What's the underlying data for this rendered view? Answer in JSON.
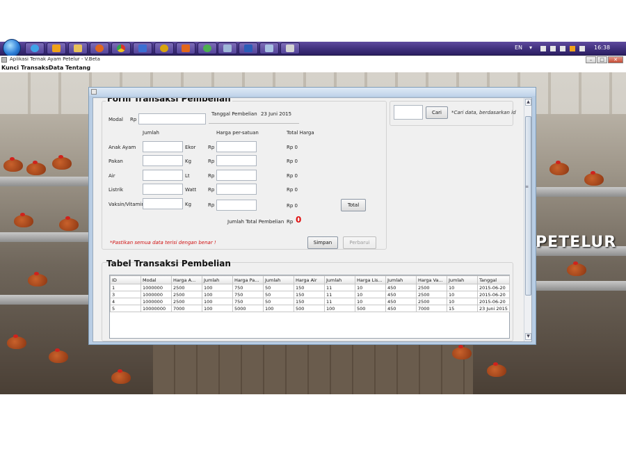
{
  "taskbar": {
    "language": "EN",
    "clock": "16:38",
    "pinned": [
      "start-orb",
      "ie-icon",
      "media-icon",
      "explorer-icon",
      "firefox-icon",
      "chrome-icon",
      "security-icon",
      "app-icon",
      "office-icon",
      "network-icon",
      "files-icon",
      "word-icon",
      "keyboard-icon",
      "java-app-icon"
    ]
  },
  "app": {
    "title": "Aplikasi Ternak Ayam Petelur - V.Beta",
    "menu": [
      "Kunci",
      "Transaksi",
      "Data",
      "Tentang"
    ],
    "brand_text": "PETELUR"
  },
  "form": {
    "title": "Form Transaksi Pembelian",
    "modal_label": "Modal",
    "currency": "Rp",
    "modal_value": "",
    "tanggal_label": "Tanggal Pembelian",
    "tanggal_value": "23 Juni 2015",
    "col_jumlah": "Jumlah",
    "col_harga": "Harga per-satuan",
    "col_total": "Total Harga",
    "rows": [
      {
        "label": "Anak Ayam",
        "unit": "Ekor",
        "jumlah": "",
        "harga": "",
        "total": "Rp  0"
      },
      {
        "label": "Pakan",
        "unit": "Kg",
        "jumlah": "",
        "harga": "",
        "total": "Rp  0"
      },
      {
        "label": "Air",
        "unit": "Lt",
        "jumlah": "",
        "harga": "",
        "total": "Rp  0"
      },
      {
        "label": "Listrik",
        "unit": "Watt",
        "jumlah": "",
        "harga": "",
        "total": "Rp  0"
      },
      {
        "label": "Vaksin/Vitamin",
        "unit": "Kg",
        "jumlah": "",
        "harga": "",
        "total": "Rp  0"
      }
    ],
    "total_button": "Total",
    "jumlah_total_label": "Jumlah Total Pembelian",
    "jumlah_total_currency": "Rp",
    "jumlah_total_value": "0",
    "note": "*Pastikan semua data terisi dengan benar !",
    "simpan_button": "Simpan",
    "perbarui_button": "Perbarui"
  },
  "search": {
    "value": "",
    "button": "Cari",
    "hint": "*Cari data, berdasarkan id"
  },
  "table": {
    "title": "Tabel Transaksi Pembelian",
    "headers": [
      "ID",
      "Modal",
      "Harga A...",
      "Jumlah",
      "Harga Pa...",
      "Jumlah",
      "Harga Air",
      "Jumlah",
      "Harga Lis...",
      "Jumlah",
      "Harga Va...",
      "Jumlah",
      "Tanggal"
    ],
    "rows": [
      [
        "1",
        "1000000",
        "2500",
        "100",
        "750",
        "50",
        "150",
        "11",
        "10",
        "450",
        "2500",
        "10",
        "2015-06-20"
      ],
      [
        "3",
        "1000000",
        "2500",
        "100",
        "750",
        "50",
        "150",
        "11",
        "10",
        "450",
        "2500",
        "10",
        "2015-06-20"
      ],
      [
        "4",
        "1000000",
        "2500",
        "100",
        "750",
        "50",
        "150",
        "11",
        "10",
        "450",
        "2500",
        "10",
        "2015-06-20"
      ],
      [
        "5",
        "10000000",
        "7000",
        "100",
        "5000",
        "100",
        "500",
        "100",
        "500",
        "450",
        "7000",
        "15",
        "23 Juni 2015"
      ]
    ]
  }
}
